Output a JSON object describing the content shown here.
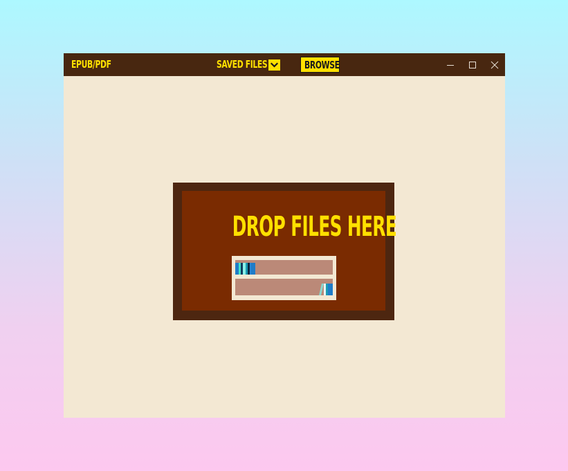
{
  "titlebar": {
    "app_title": "EPUB/PDF",
    "saved_files_label": "SAVED FILES",
    "browse_label": "BROWSE"
  },
  "dropzone": {
    "label": "DROP FILES HERE"
  },
  "colors": {
    "titlebar_bg": "#482710",
    "accent": "#ffe000",
    "window_bg": "#f3e8d3",
    "dropzone_frame": "#4d2610",
    "dropzone_fill": "#7a2b01",
    "shelf_slot": "#bb8978"
  },
  "icons": {
    "dropdown": "chevron-down-icon",
    "minimize": "minimize-icon",
    "maximize": "maximize-icon",
    "close": "close-icon",
    "illustration": "bookshelf-icon"
  }
}
